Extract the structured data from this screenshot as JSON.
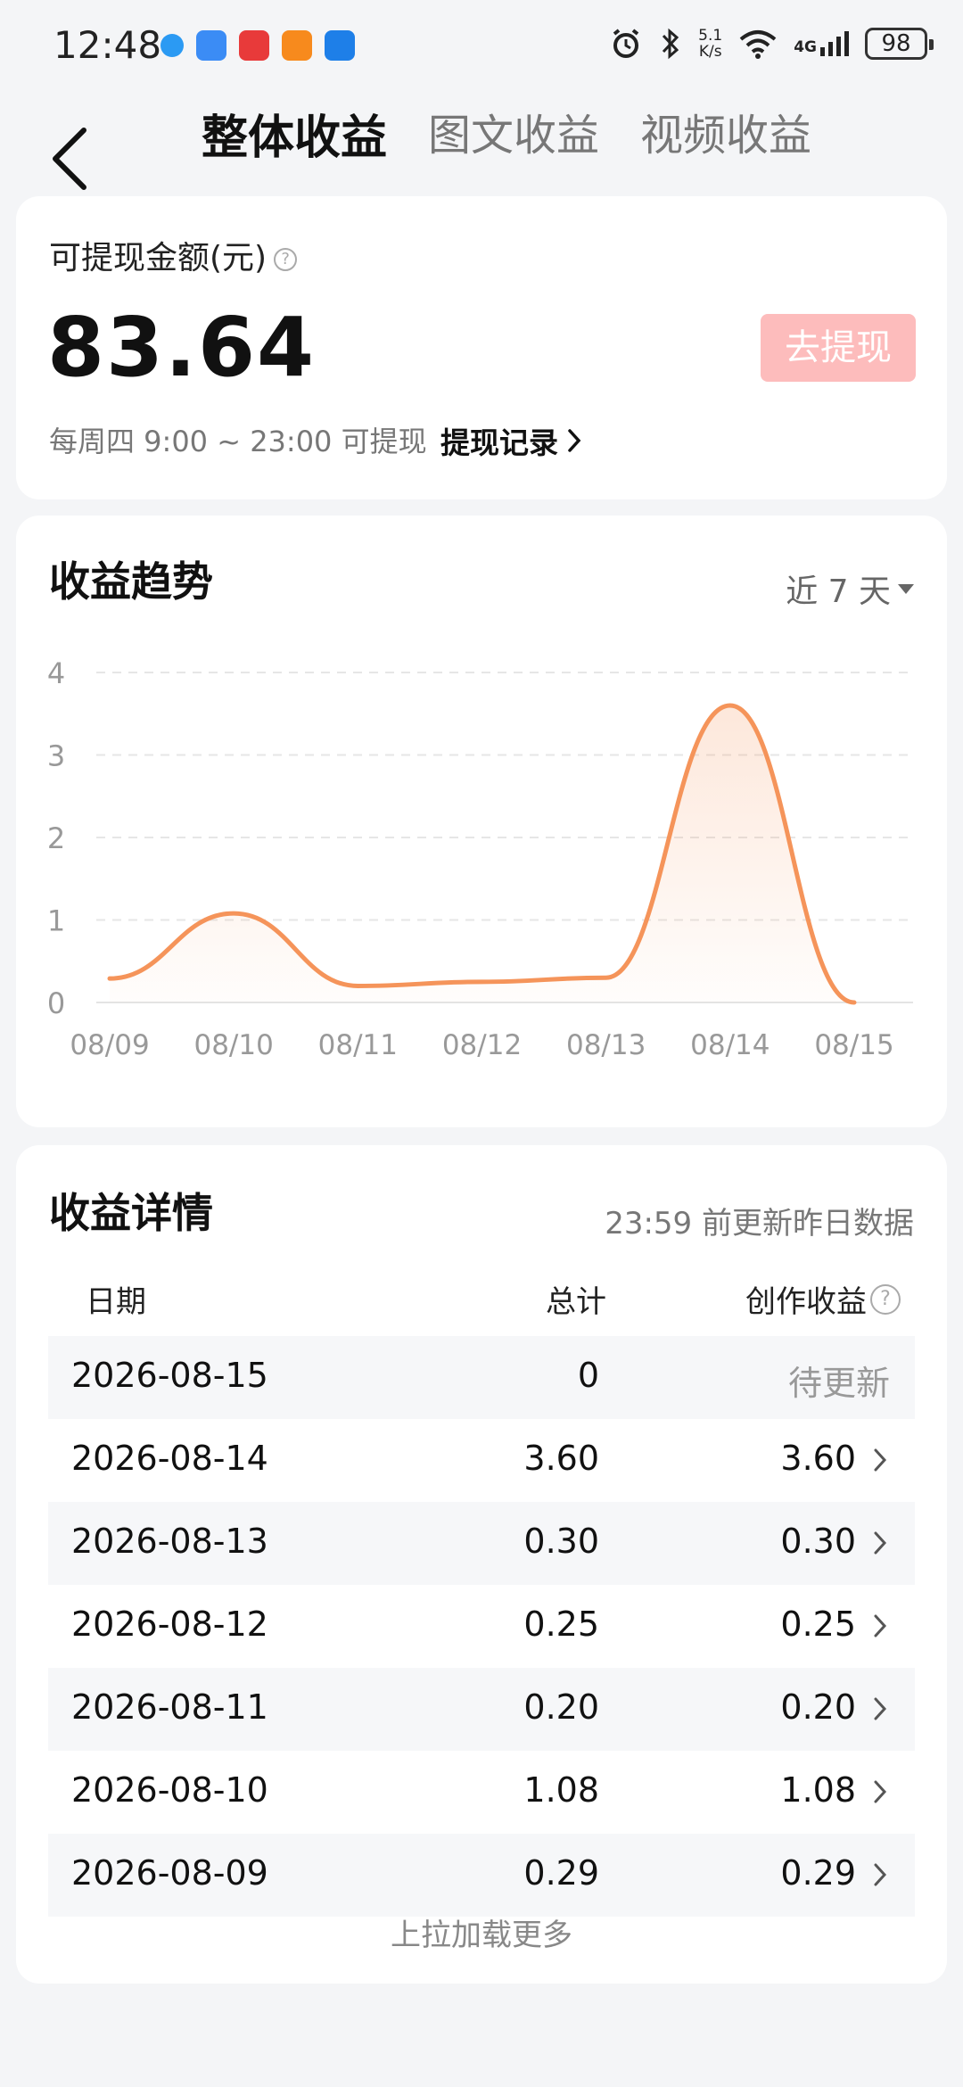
{
  "status_bar": {
    "time": "12:48",
    "net_speed_value": "5.1",
    "net_speed_unit": "K/s",
    "signal": "4G",
    "battery": "98"
  },
  "tabs": [
    {
      "label": "整体收益",
      "active": true
    },
    {
      "label": "图文收益",
      "active": false
    },
    {
      "label": "视频收益",
      "active": false
    }
  ],
  "withdraw": {
    "label": "可提现金额(元)",
    "amount": "83.64",
    "button": "去提现",
    "schedule_note": "每周四 9:00 ~ 23:00 可提现",
    "record_link": "提现记录",
    "button_color": "#fdbcbc"
  },
  "trend": {
    "title": "收益趋势",
    "range": "近 7 天"
  },
  "chart_data": {
    "type": "line",
    "x": [
      "08/09",
      "08/10",
      "08/11",
      "08/12",
      "08/13",
      "08/14",
      "08/15"
    ],
    "series": [
      {
        "values": [
          0.29,
          1.08,
          0.2,
          0.25,
          0.3,
          3.6,
          0
        ]
      }
    ],
    "ylim": [
      0,
      4
    ],
    "yticks": [
      "0",
      "1",
      "2",
      "3",
      "4"
    ],
    "grid": true,
    "line_color": "#f5945a"
  },
  "details": {
    "title": "收益详情",
    "update_note": "23:59 前更新昨日数据",
    "columns": {
      "date": "日期",
      "total": "总计",
      "earning": "创作收益"
    },
    "rows": [
      {
        "date": "2026-08-15",
        "total": "0",
        "earning": "待更新",
        "pending": true
      },
      {
        "date": "2026-08-14",
        "total": "3.60",
        "earning": "3.60",
        "pending": false
      },
      {
        "date": "2026-08-13",
        "total": "0.30",
        "earning": "0.30",
        "pending": false
      },
      {
        "date": "2026-08-12",
        "total": "0.25",
        "earning": "0.25",
        "pending": false
      },
      {
        "date": "2026-08-11",
        "total": "0.20",
        "earning": "0.20",
        "pending": false
      },
      {
        "date": "2026-08-10",
        "total": "1.08",
        "earning": "1.08",
        "pending": false
      },
      {
        "date": "2026-08-09",
        "total": "0.29",
        "earning": "0.29",
        "pending": false
      }
    ],
    "load_more": "上拉加载更多"
  }
}
